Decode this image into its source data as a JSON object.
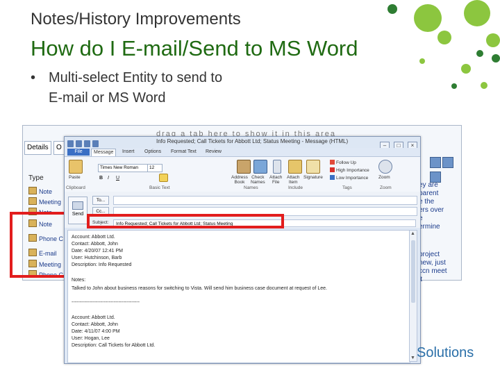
{
  "slide": {
    "subtitle": "Notes/History Improvements",
    "title": "How do I E-mail/Send to MS Word",
    "bullet_line1": "Multi-select Entity to send to",
    "bullet_line2": "E-mail or MS Word",
    "bullet_symbol": "•",
    "logo_text": "Solutions"
  },
  "background_window": {
    "group_hint": "drag a tab here to show it in this area",
    "tabs": [
      "Details",
      "O"
    ],
    "type_header": "Type",
    "rows": [
      "Note",
      "Meeting",
      "Note",
      "Note",
      "Phone C",
      "E-mail",
      "Meeting",
      "Phone C"
    ],
    "right_text": [
      "ey are",
      "parent",
      "e the",
      "ers over",
      "e",
      "ermine"
    ],
    "right_text2": [
      "project",
      "new, just",
      "ccn meet",
      "it"
    ]
  },
  "message_window": {
    "title": "Info Requested; Call Tickets for Abbott Ltd; Status Meeting - Message (HTML)",
    "tabs": [
      "File",
      "Message",
      "Insert",
      "Options",
      "Format Text",
      "Review"
    ],
    "ribbon": {
      "paste": "Paste",
      "clipboard": "Clipboard",
      "font_name": "Times New Roman",
      "font_size": "12",
      "basic_text": "Basic Text",
      "address_book": "Address Book",
      "check_names": "Check Names",
      "names": "Names",
      "attach_file": "Attach File",
      "attach_item": "Attach Item",
      "signature": "Signature",
      "include": "Include",
      "follow_up": "Follow Up",
      "high_importance": "High Importance",
      "low_importance": "Low Importance",
      "tags": "Tags",
      "zoom": "Zoom",
      "zoom_group": "Zoom"
    },
    "send": "Send",
    "to_button": "To...",
    "cc_button": "Cc...",
    "subject_label": "Subject:",
    "subject_value": "Info Requested; Call Tickets for Abbott Ltd; Status Meeting",
    "body_lines": [
      "Account: Abbott Ltd.",
      "Contact: Abbott, John",
      "Date: 4/20/07 12:41 PM",
      "User: Hutchinson, Barb",
      "Description: Info Requested",
      "",
      "Notes:",
      "Talked to John about business reasons for switching to Vista. Will send him business case document at request of Lee.",
      "",
      "------------------------------------------",
      "",
      "Account: Abbott Ltd.",
      "Contact: Abbott, John",
      "Date: 4/11/07 4:00 PM",
      "User: Hogan, Lee",
      "Description: Call Tickets for Abbott Ltd."
    ]
  },
  "colors": {
    "title_green": "#1f6a12",
    "highlight_red": "#e21d1d",
    "logo_blue": "#2a6fa8",
    "dot_light": "#8cc63f",
    "dot_dark": "#2e7d32"
  }
}
